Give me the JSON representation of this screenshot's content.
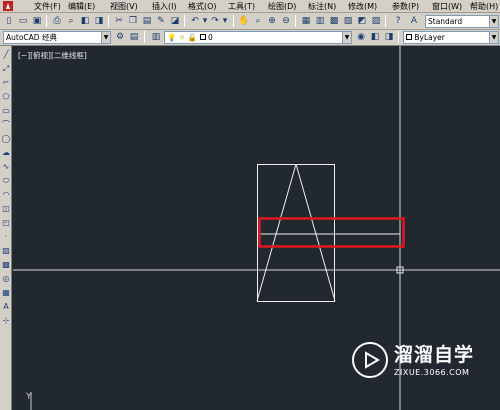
{
  "menu": {
    "items": [
      "文件(F)",
      "编辑(E)",
      "视图(V)",
      "插入(I)",
      "格式(O)",
      "工具(T)",
      "绘图(D)",
      "标注(N)",
      "修改(M)",
      "参数(P)",
      "窗口(W)",
      "帮助(H)"
    ]
  },
  "toolbar1": {
    "text_style": "Standard"
  },
  "toolbar2": {
    "workspace": "AutoCAD 经典",
    "layer": "0",
    "color": "ByLayer"
  },
  "viewport": {
    "label": "[−][俯视][二维线框]",
    "ucs_label": "Y",
    "highlight_color": "#e0181e",
    "line_color": "#ffffff"
  },
  "watermark": {
    "title": "溜溜自学",
    "url": "ZIXUE.3066.COM"
  }
}
